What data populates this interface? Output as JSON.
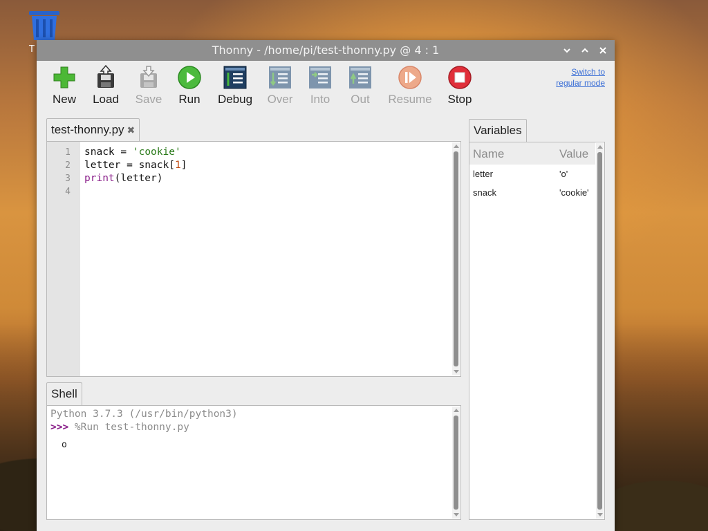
{
  "desktop": {
    "trash_label": "T",
    "trash_icon": "trash-icon"
  },
  "window": {
    "title": "Thonny  -  /home/pi/test-thonny.py  @  4 : 1",
    "controls": [
      "minimize-icon",
      "maximize-icon",
      "close-icon"
    ]
  },
  "toolbar": {
    "new": "New",
    "load": "Load",
    "save": "Save",
    "run": "Run",
    "debug": "Debug",
    "over": "Over",
    "into": "Into",
    "out": "Out",
    "resume": "Resume",
    "stop": "Stop"
  },
  "switch_mode": {
    "line1": "Switch to",
    "line2": "regular mode"
  },
  "editor": {
    "tab_label": "test-thonny.py",
    "line_numbers": [
      "1",
      "2",
      "3",
      "4"
    ],
    "code": {
      "l1_var": "snack",
      "l1_op": " = ",
      "l1_str": "'cookie'",
      "l2_a": "letter = snack[",
      "l2_num": "1",
      "l2_b": "]",
      "l3_kw": "print",
      "l3_rest": "(letter)"
    }
  },
  "shell": {
    "tab_label": "Shell",
    "banner": "Python 3.7.3 (/usr/bin/python3)",
    "prompt": ">>>",
    "command": " %Run test-thonny.py",
    "output": "o"
  },
  "variables": {
    "tab_label": "Variables",
    "col_name": "Name",
    "col_value": "Value",
    "rows": [
      {
        "name": "letter",
        "value": "'o'"
      },
      {
        "name": "snack",
        "value": "'cookie'"
      }
    ]
  },
  "colors": {
    "titlebar": "#8f8f8f",
    "string": "#2a7a1a",
    "keyword": "#8a1f8a",
    "number": "#c04a10",
    "link": "#3b6fd6"
  }
}
